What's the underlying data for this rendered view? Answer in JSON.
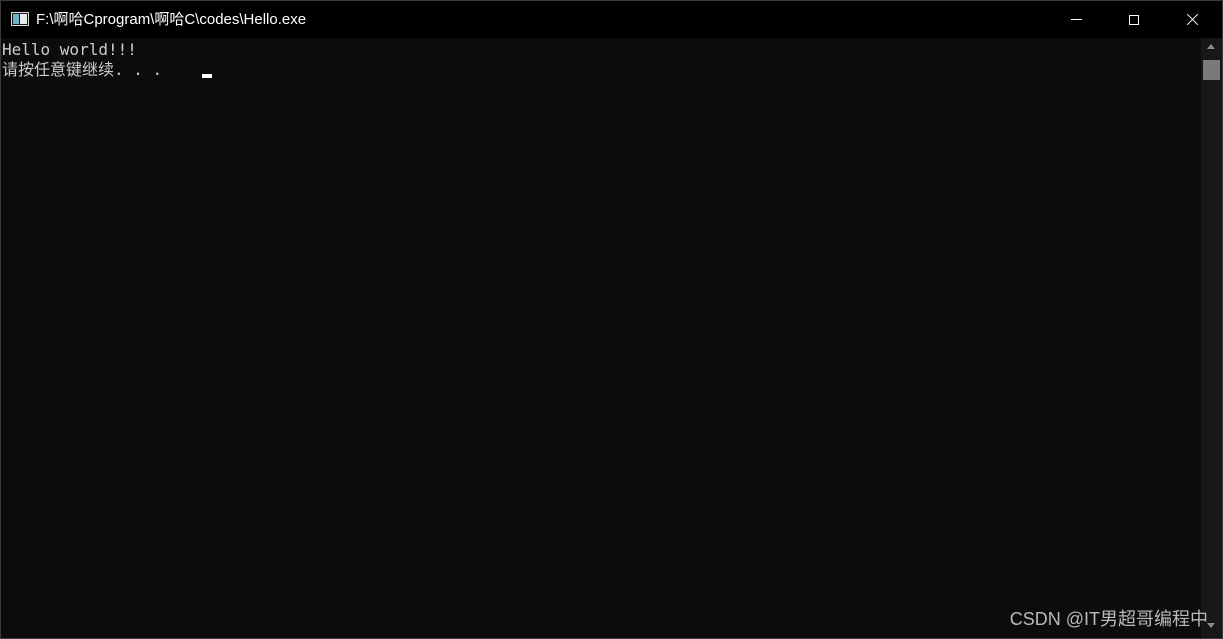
{
  "window": {
    "title": "F:\\啊哈Cprogram\\啊哈C\\codes\\Hello.exe",
    "icon": "console-app-icon",
    "controls": {
      "minimize_icon": "minimize-icon",
      "maximize_icon": "maximize-icon",
      "close_icon": "close-icon"
    }
  },
  "console": {
    "lines": [
      "Hello world!!!",
      "请按任意键继续. . . "
    ],
    "text_color": "#cccccc",
    "background_color": "#0c0c0c",
    "cursor_color": "#ffffff"
  },
  "watermark": {
    "text": "CSDN @IT男超哥编程中"
  }
}
